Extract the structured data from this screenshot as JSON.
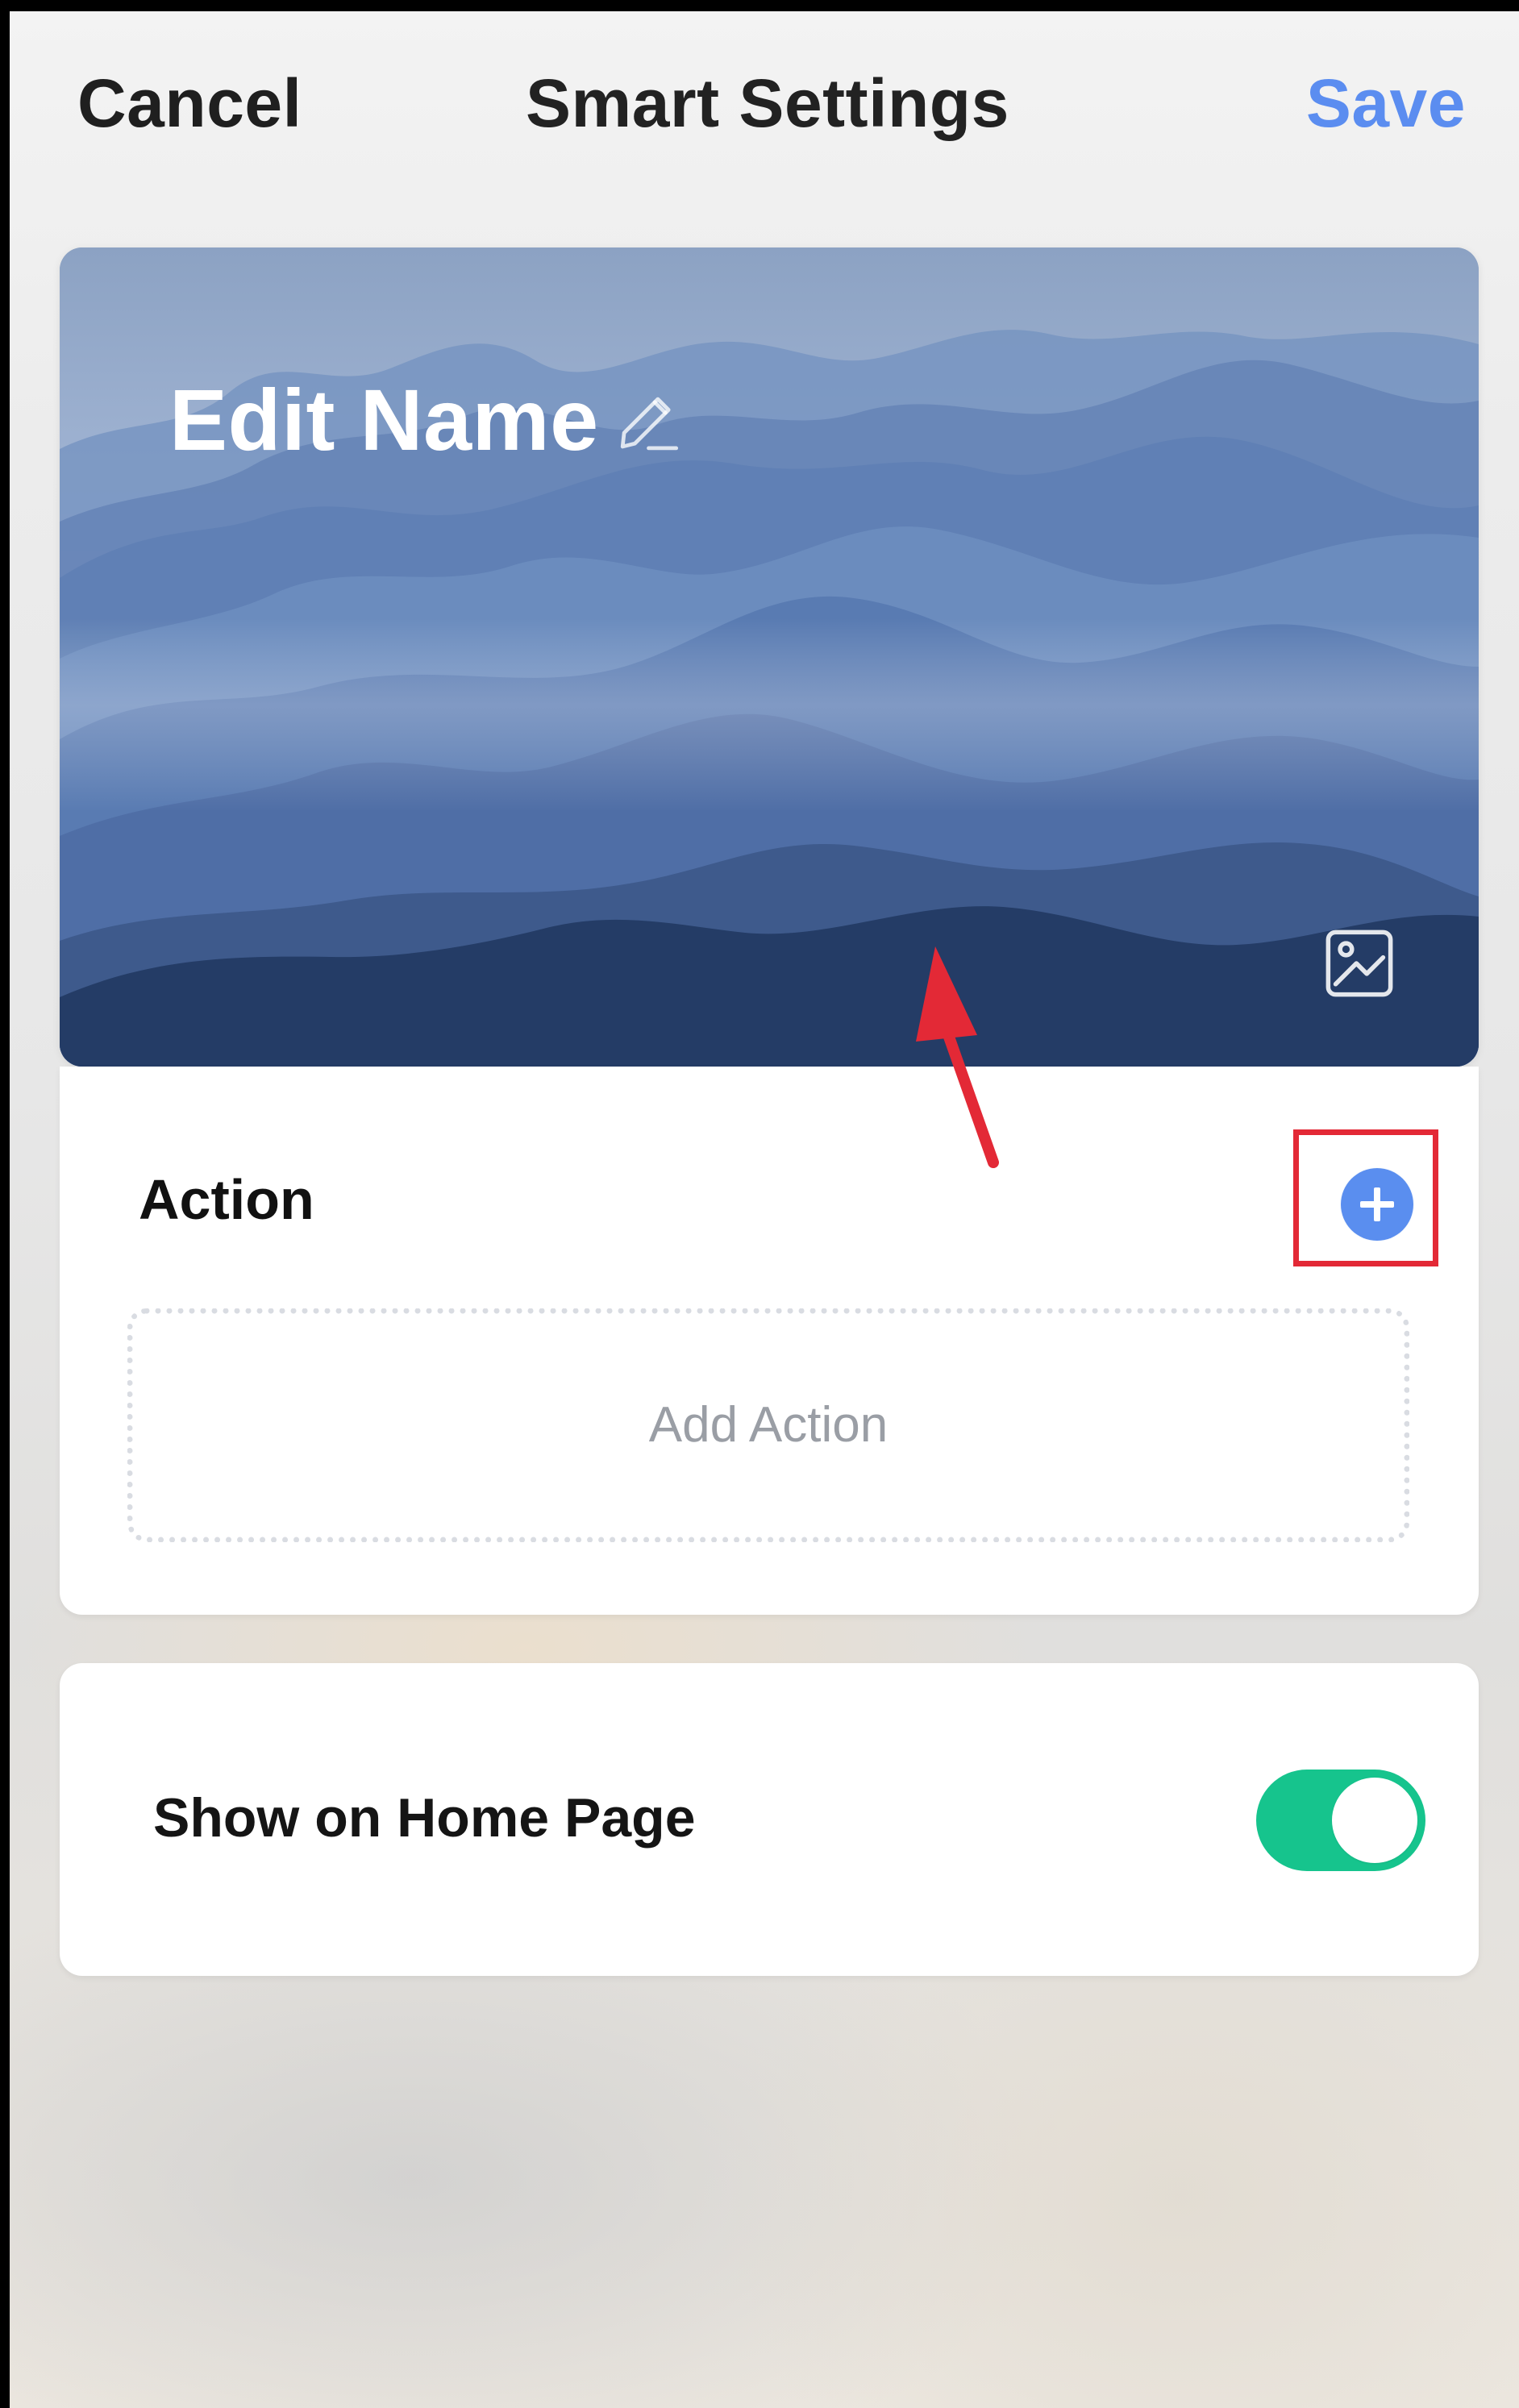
{
  "header": {
    "cancel_label": "Cancel",
    "title": "Smart Settings",
    "save_label": "Save"
  },
  "hero": {
    "title": "Edit Name",
    "edit_icon": "pencil-icon",
    "image_icon": "image-icon"
  },
  "action_section": {
    "label": "Action",
    "add_button_icon": "plus-icon",
    "empty_state": "Add Action"
  },
  "home_page_section": {
    "label": "Show on Home Page",
    "toggle_state": "on"
  },
  "colors": {
    "accent_blue": "#5b8df0",
    "toggle_green": "#16c48d",
    "highlight_red": "#e32936"
  }
}
